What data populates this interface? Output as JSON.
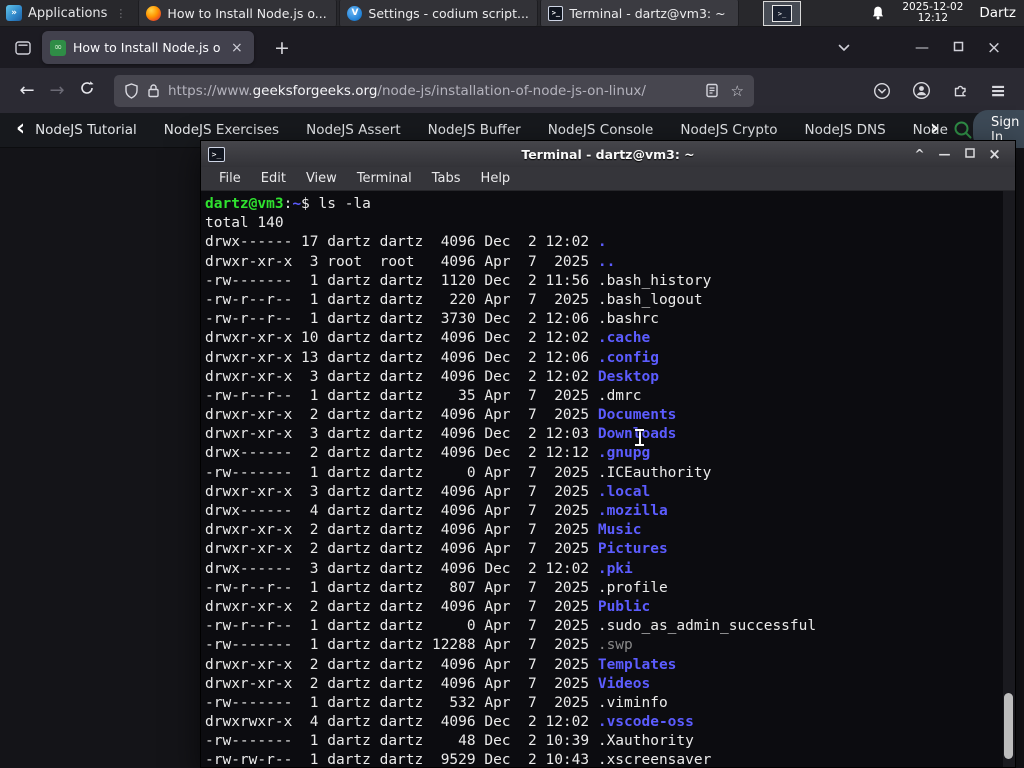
{
  "glyphs": {
    "back": "←",
    "forward": "→",
    "new_tab": "+",
    "tab_close": "×",
    "window_minimize": "—",
    "window_close": "×",
    "star": "☆",
    "hamburger": "≡",
    "nav_prev": "‹",
    "nav_more": "›",
    "shade": "^",
    "apps_grip": "⋮",
    "terminal_glyph": ">_",
    "favicon_glyph": "∞",
    "codium_glyph": "V"
  },
  "panel": {
    "applications_label": "Applications",
    "window_buttons": [
      {
        "label": "How to Install Node.js o...",
        "icon": "firefox-icon"
      },
      {
        "label": "Settings - codium script...",
        "icon": "vscodium-icon"
      },
      {
        "label": "Terminal - dartz@vm3: ~",
        "icon": "terminal-icon"
      }
    ],
    "clock_date": "2025-12-02",
    "clock_time": "12:12",
    "user_label": "Dartz"
  },
  "browser": {
    "tab_title": "How to Install Node.js on",
    "url_protocol": "https://www.",
    "url_domain": "geeksforgeeks.org",
    "url_path": "/node-js/installation-of-node-js-on-linux/"
  },
  "site_nav": {
    "items": [
      "NodeJS Tutorial",
      "NodeJS Exercises",
      "NodeJS Assert",
      "NodeJS Buffer",
      "NodeJS Console",
      "NodeJS Crypto",
      "NodeJS DNS",
      "Node"
    ],
    "sign_in_label": "Sign In",
    "search_color": "#2f8d46"
  },
  "terminal": {
    "title": "Terminal - dartz@vm3: ~",
    "menu_items": [
      "File",
      "Edit",
      "View",
      "Terminal",
      "Tabs",
      "Help"
    ],
    "prompt": {
      "user_host": "dartz@vm3",
      "separator": ":",
      "cwd": "~",
      "symbol": "$",
      "command": "ls -la"
    },
    "total_line": "total 140",
    "colors": {
      "directory": "#5c5cff",
      "file": "#ebebeb",
      "dim_file": "#8a8a8a",
      "prompt_green": "#2fe22f"
    },
    "listing": [
      {
        "perms": "drwx------",
        "links": "17",
        "owner": "dartz",
        "group": "dartz",
        "size": "4096",
        "month": "Dec",
        "day": "2",
        "time": "12:02",
        "name": ".",
        "kind": "dir"
      },
      {
        "perms": "drwxr-xr-x",
        "links": "3",
        "owner": "root",
        "group": "root",
        "size": "4096",
        "month": "Apr",
        "day": "7",
        "time": "2025",
        "name": "..",
        "kind": "dir"
      },
      {
        "perms": "-rw-------",
        "links": "1",
        "owner": "dartz",
        "group": "dartz",
        "size": "1120",
        "month": "Dec",
        "day": "2",
        "time": "11:56",
        "name": ".bash_history",
        "kind": "file"
      },
      {
        "perms": "-rw-r--r--",
        "links": "1",
        "owner": "dartz",
        "group": "dartz",
        "size": "220",
        "month": "Apr",
        "day": "7",
        "time": "2025",
        "name": ".bash_logout",
        "kind": "file"
      },
      {
        "perms": "-rw-r--r--",
        "links": "1",
        "owner": "dartz",
        "group": "dartz",
        "size": "3730",
        "month": "Dec",
        "day": "2",
        "time": "12:06",
        "name": ".bashrc",
        "kind": "file"
      },
      {
        "perms": "drwxr-xr-x",
        "links": "10",
        "owner": "dartz",
        "group": "dartz",
        "size": "4096",
        "month": "Dec",
        "day": "2",
        "time": "12:02",
        "name": ".cache",
        "kind": "dir"
      },
      {
        "perms": "drwxr-xr-x",
        "links": "13",
        "owner": "dartz",
        "group": "dartz",
        "size": "4096",
        "month": "Dec",
        "day": "2",
        "time": "12:06",
        "name": ".config",
        "kind": "dir"
      },
      {
        "perms": "drwxr-xr-x",
        "links": "3",
        "owner": "dartz",
        "group": "dartz",
        "size": "4096",
        "month": "Dec",
        "day": "2",
        "time": "12:02",
        "name": "Desktop",
        "kind": "dir"
      },
      {
        "perms": "-rw-r--r--",
        "links": "1",
        "owner": "dartz",
        "group": "dartz",
        "size": "35",
        "month": "Apr",
        "day": "7",
        "time": "2025",
        "name": ".dmrc",
        "kind": "file"
      },
      {
        "perms": "drwxr-xr-x",
        "links": "2",
        "owner": "dartz",
        "group": "dartz",
        "size": "4096",
        "month": "Apr",
        "day": "7",
        "time": "2025",
        "name": "Documents",
        "kind": "dir"
      },
      {
        "perms": "drwxr-xr-x",
        "links": "3",
        "owner": "dartz",
        "group": "dartz",
        "size": "4096",
        "month": "Dec",
        "day": "2",
        "time": "12:03",
        "name": "Downloads",
        "kind": "dir"
      },
      {
        "perms": "drwx------",
        "links": "2",
        "owner": "dartz",
        "group": "dartz",
        "size": "4096",
        "month": "Dec",
        "day": "2",
        "time": "12:12",
        "name": ".gnupg",
        "kind": "dir"
      },
      {
        "perms": "-rw-------",
        "links": "1",
        "owner": "dartz",
        "group": "dartz",
        "size": "0",
        "month": "Apr",
        "day": "7",
        "time": "2025",
        "name": ".ICEauthority",
        "kind": "file"
      },
      {
        "perms": "drwxr-xr-x",
        "links": "3",
        "owner": "dartz",
        "group": "dartz",
        "size": "4096",
        "month": "Apr",
        "day": "7",
        "time": "2025",
        "name": ".local",
        "kind": "dir"
      },
      {
        "perms": "drwx------",
        "links": "4",
        "owner": "dartz",
        "group": "dartz",
        "size": "4096",
        "month": "Apr",
        "day": "7",
        "time": "2025",
        "name": ".mozilla",
        "kind": "dir"
      },
      {
        "perms": "drwxr-xr-x",
        "links": "2",
        "owner": "dartz",
        "group": "dartz",
        "size": "4096",
        "month": "Apr",
        "day": "7",
        "time": "2025",
        "name": "Music",
        "kind": "dir"
      },
      {
        "perms": "drwxr-xr-x",
        "links": "2",
        "owner": "dartz",
        "group": "dartz",
        "size": "4096",
        "month": "Apr",
        "day": "7",
        "time": "2025",
        "name": "Pictures",
        "kind": "dir"
      },
      {
        "perms": "drwx------",
        "links": "3",
        "owner": "dartz",
        "group": "dartz",
        "size": "4096",
        "month": "Dec",
        "day": "2",
        "time": "12:02",
        "name": ".pki",
        "kind": "dir"
      },
      {
        "perms": "-rw-r--r--",
        "links": "1",
        "owner": "dartz",
        "group": "dartz",
        "size": "807",
        "month": "Apr",
        "day": "7",
        "time": "2025",
        "name": ".profile",
        "kind": "file"
      },
      {
        "perms": "drwxr-xr-x",
        "links": "2",
        "owner": "dartz",
        "group": "dartz",
        "size": "4096",
        "month": "Apr",
        "day": "7",
        "time": "2025",
        "name": "Public",
        "kind": "dir"
      },
      {
        "perms": "-rw-r--r--",
        "links": "1",
        "owner": "dartz",
        "group": "dartz",
        "size": "0",
        "month": "Apr",
        "day": "7",
        "time": "2025",
        "name": ".sudo_as_admin_successful",
        "kind": "file"
      },
      {
        "perms": "-rw-------",
        "links": "1",
        "owner": "dartz",
        "group": "dartz",
        "size": "12288",
        "month": "Apr",
        "day": "7",
        "time": "2025",
        "name": ".swp",
        "kind": "dim"
      },
      {
        "perms": "drwxr-xr-x",
        "links": "2",
        "owner": "dartz",
        "group": "dartz",
        "size": "4096",
        "month": "Apr",
        "day": "7",
        "time": "2025",
        "name": "Templates",
        "kind": "dir"
      },
      {
        "perms": "drwxr-xr-x",
        "links": "2",
        "owner": "dartz",
        "group": "dartz",
        "size": "4096",
        "month": "Apr",
        "day": "7",
        "time": "2025",
        "name": "Videos",
        "kind": "dir"
      },
      {
        "perms": "-rw-------",
        "links": "1",
        "owner": "dartz",
        "group": "dartz",
        "size": "532",
        "month": "Apr",
        "day": "7",
        "time": "2025",
        "name": ".viminfo",
        "kind": "file"
      },
      {
        "perms": "drwxrwxr-x",
        "links": "4",
        "owner": "dartz",
        "group": "dartz",
        "size": "4096",
        "month": "Dec",
        "day": "2",
        "time": "12:02",
        "name": ".vscode-oss",
        "kind": "dir"
      },
      {
        "perms": "-rw-------",
        "links": "1",
        "owner": "dartz",
        "group": "dartz",
        "size": "48",
        "month": "Dec",
        "day": "2",
        "time": "10:39",
        "name": ".Xauthority",
        "kind": "file"
      },
      {
        "perms": "-rw-rw-r--",
        "links": "1",
        "owner": "dartz",
        "group": "dartz",
        "size": "9529",
        "month": "Dec",
        "day": "2",
        "time": "10:43",
        "name": ".xscreensaver",
        "kind": "file"
      }
    ]
  }
}
